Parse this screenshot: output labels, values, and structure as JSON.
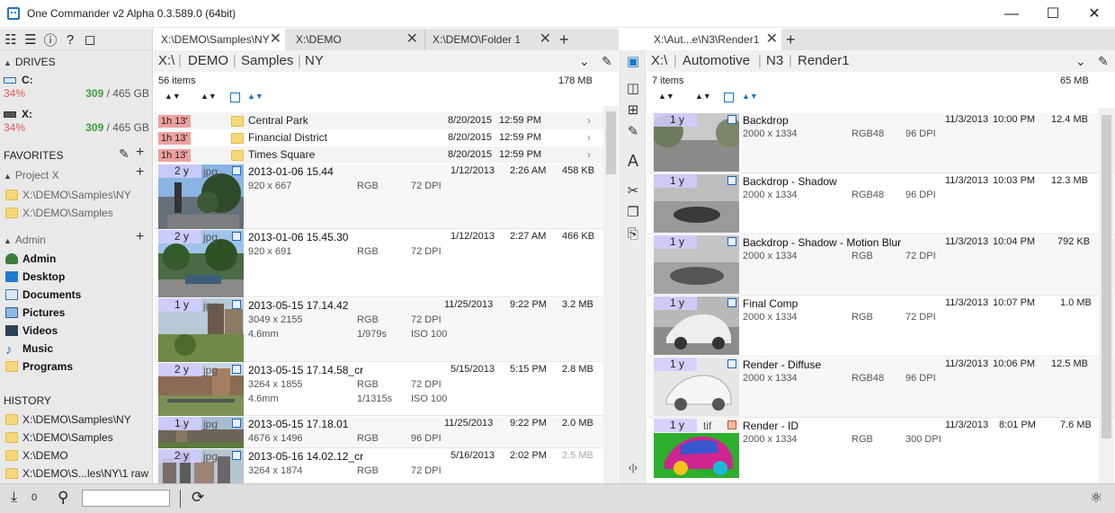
{
  "window": {
    "title": "One Commander v2 Alpha 0.3.589.0 (64bit)"
  },
  "sidebar": {
    "drives_label": "DRIVES",
    "drives": [
      {
        "name": "C:",
        "used_pct": "34%",
        "free": "309",
        "total": "/ 465 GB"
      },
      {
        "name": "X:",
        "used_pct": "34%",
        "free": "309",
        "total": "/ 465 GB"
      }
    ],
    "favorites_label": "FAVORITES",
    "group_project": "Project X",
    "project_items": [
      "X:\\DEMO\\Samples\\NY",
      "X:\\DEMO\\Samples"
    ],
    "group_admin": "Admin",
    "admin_items": [
      "Admin",
      "Desktop",
      "Documents",
      "Pictures",
      "Videos",
      "Music",
      "Programs"
    ],
    "history_label": "HISTORY",
    "history_items": [
      "X:\\DEMO\\Samples\\NY",
      "X:\\DEMO\\Samples",
      "X:\\DEMO",
      "X:\\DEMO\\S...les\\NY\\1 raw"
    ]
  },
  "left": {
    "tabs": [
      "X:\\DEMO\\Samples\\NY",
      "X:\\DEMO",
      "X:\\DEMO\\Folder 1"
    ],
    "breadcrumb": [
      "X:\\",
      "DEMO",
      "Samples",
      "NY"
    ],
    "item_count": "56 items",
    "total_size": "178 MB",
    "folders": [
      {
        "age": "1h 13'",
        "name": "Central Park",
        "date": "8/20/2015",
        "time": "12:59 PM"
      },
      {
        "age": "1h 13'",
        "name": "Financial District",
        "date": "8/20/2015",
        "time": "12:59 PM"
      },
      {
        "age": "1h 13'",
        "name": "Times Square",
        "date": "8/20/2015",
        "time": "12:59 PM"
      }
    ],
    "files": [
      {
        "age": "2 y",
        "ext": "jpg",
        "name": "2013-01-06 15.44",
        "dims": "920 x 667",
        "color": "RGB",
        "dpi": "72 DPI",
        "lens": "",
        "shutter": "",
        "iso": "",
        "date": "1/12/2013",
        "time": "2:26 AM",
        "size": "458 KB"
      },
      {
        "age": "2 y",
        "ext": "jpg",
        "name": "2013-01-06 15.45.30",
        "dims": "920 x 691",
        "color": "RGB",
        "dpi": "72 DPI",
        "lens": "",
        "shutter": "",
        "iso": "",
        "date": "1/12/2013",
        "time": "2:27 AM",
        "size": "466 KB"
      },
      {
        "age": "1 y",
        "ext": "jpg",
        "name": "2013-05-15 17.14.42",
        "dims": "3049 x 2155",
        "color": "RGB",
        "dpi": "72 DPI",
        "lens": "4.6mm",
        "shutter": "1/979s",
        "iso": "ISO 100",
        "date": "11/25/2013",
        "time": "9:22 PM",
        "size": "3.2 MB"
      },
      {
        "age": "2 y",
        "ext": "jpg",
        "name": "2013-05-15 17.14.58_cr",
        "dims": "3264 x 1855",
        "color": "RGB",
        "dpi": "72 DPI",
        "lens": "4.6mm",
        "shutter": "1/1315s",
        "iso": "ISO 100",
        "date": "5/15/2013",
        "time": "5:15 PM",
        "size": "2.8 MB"
      },
      {
        "age": "1 y",
        "ext": "jpg",
        "name": "2013-05-15 17.18.01",
        "dims": "4676 x 1496",
        "color": "RGB",
        "dpi": "96 DPI",
        "lens": "",
        "shutter": "",
        "iso": "",
        "date": "11/25/2013",
        "time": "9:22 PM",
        "size": "2.0 MB"
      },
      {
        "age": "2 y",
        "ext": "jpg",
        "name": "2013-05-16 14.02.12_cr",
        "dims": "3264 x 1874",
        "color": "RGB",
        "dpi": "72 DPI",
        "lens": "",
        "shutter": "",
        "iso": "",
        "date": "5/16/2013",
        "time": "2:02 PM",
        "size": "2.5 MB"
      }
    ]
  },
  "right": {
    "tab": "X:\\Aut...e\\N3\\Render1",
    "breadcrumb": [
      "X:\\",
      "Automotive",
      "N3",
      "Render1"
    ],
    "item_count": "7 items",
    "total_size": "65 MB",
    "files": [
      {
        "age": "1 y",
        "ext": "",
        "name": "Backdrop",
        "dims": "2000 x 1334",
        "color": "RGB48",
        "dpi": "96 DPI",
        "date": "11/3/2013",
        "time": "10:00 PM",
        "size": "12.4 MB"
      },
      {
        "age": "1 y",
        "ext": "",
        "name": "Backdrop - Shadow",
        "dims": "2000 x 1334",
        "color": "RGB48",
        "dpi": "96 DPI",
        "date": "11/3/2013",
        "time": "10:03 PM",
        "size": "12.3 MB"
      },
      {
        "age": "1 y",
        "ext": "",
        "name": "Backdrop - Shadow - Motion Blur",
        "dims": "2000 x 1334",
        "color": "RGB",
        "dpi": "72 DPI",
        "date": "11/3/2013",
        "time": "10:04 PM",
        "size": "792 KB"
      },
      {
        "age": "1 y",
        "ext": "",
        "name": "Final Comp",
        "dims": "2000 x 1334",
        "color": "RGB",
        "dpi": "72 DPI",
        "date": "11/3/2013",
        "time": "10:07 PM",
        "size": "1.0 MB"
      },
      {
        "age": "1 y",
        "ext": "",
        "name": "Render - Diffuse",
        "dims": "2000 x 1334",
        "color": "RGB48",
        "dpi": "96 DPI",
        "date": "11/3/2013",
        "time": "10:06 PM",
        "size": "12.5 MB"
      },
      {
        "age": "1 y",
        "ext": "tif",
        "name": "Render - ID",
        "dims": "2000 x 1334",
        "color": "RGB",
        "dpi": "300 DPI",
        "date": "11/3/2013",
        "time": "8:01 PM",
        "size": "7.6 MB"
      }
    ]
  },
  "status": {
    "selected_count": "0",
    "search_placeholder": ""
  },
  "colors": {
    "accent": "#1a78c2",
    "age_badge": "#f0a0a0",
    "free_space": "#3f9f3a",
    "used_pct": "#e05a50"
  }
}
